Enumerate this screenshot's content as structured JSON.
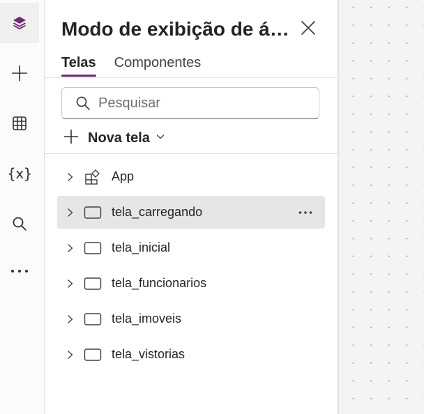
{
  "panel": {
    "title": "Modo de exibição de á…",
    "tabs": [
      {
        "label": "Telas",
        "selected": true
      },
      {
        "label": "Componentes",
        "selected": false
      }
    ],
    "search": {
      "placeholder": "Pesquisar",
      "value": ""
    },
    "new_screen_label": "Nova tela",
    "tree": [
      {
        "label": "App",
        "icon": "app-icon",
        "selected": false
      },
      {
        "label": "tela_carregando",
        "icon": "screen-icon",
        "selected": true
      },
      {
        "label": "tela_inicial",
        "icon": "screen-icon",
        "selected": false
      },
      {
        "label": "tela_funcionarios",
        "icon": "screen-icon",
        "selected": false
      },
      {
        "label": "tela_imoveis",
        "icon": "screen-icon",
        "selected": false
      },
      {
        "label": "tela_vistorias",
        "icon": "screen-icon",
        "selected": false
      }
    ]
  },
  "rail": {
    "items": [
      {
        "icon": "tree-view-icon",
        "active": true
      },
      {
        "icon": "insert-plus-icon",
        "active": false
      },
      {
        "icon": "data-table-icon",
        "active": false
      },
      {
        "icon": "variables-icon",
        "glyph": "{x}",
        "active": false
      },
      {
        "icon": "search-icon",
        "active": false
      },
      {
        "icon": "more-options-icon",
        "active": false
      }
    ]
  },
  "colors": {
    "accent": "#742774",
    "selected_row": "#e6e6e6",
    "canvas": "#f4f4f4"
  }
}
